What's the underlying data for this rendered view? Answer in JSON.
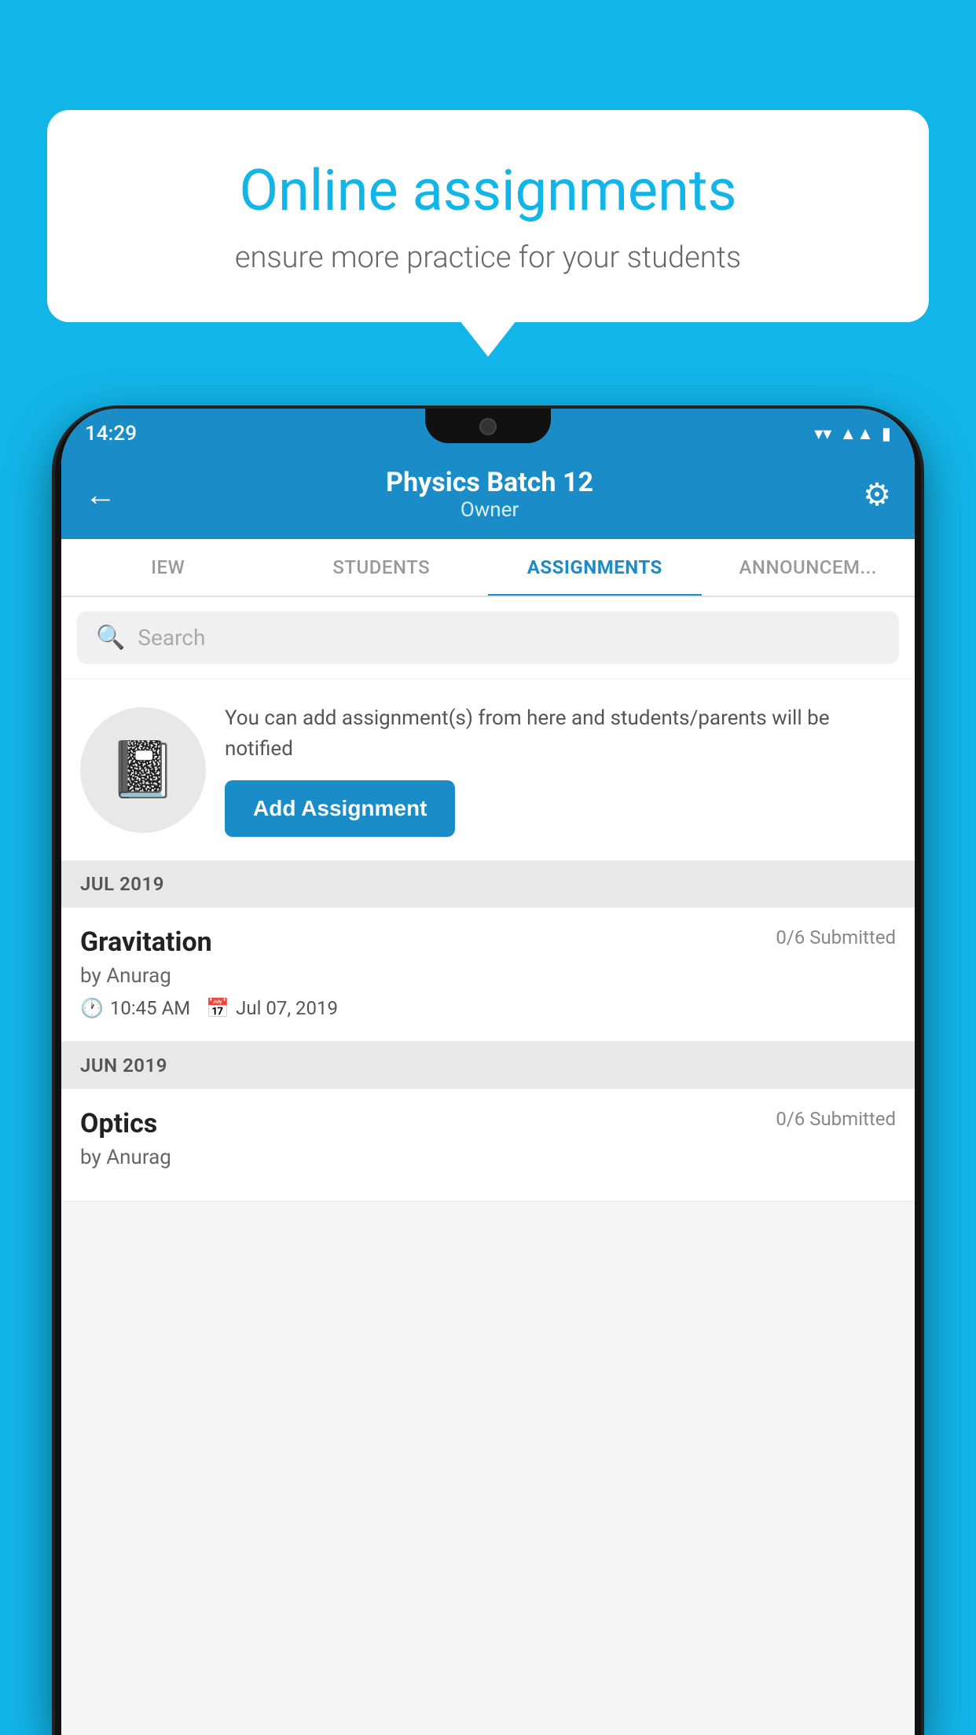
{
  "background_color": "#12B5E8",
  "speech_bubble": {
    "title": "Online assignments",
    "subtitle": "ensure more practice for your students"
  },
  "status_bar": {
    "time": "14:29",
    "wifi": "▼",
    "signal": "▲",
    "battery": "▮"
  },
  "header": {
    "title": "Physics Batch 12",
    "subtitle": "Owner",
    "back_label": "←",
    "gear_label": "⚙"
  },
  "tabs": [
    {
      "label": "IEW",
      "active": false
    },
    {
      "label": "STUDENTS",
      "active": false
    },
    {
      "label": "ASSIGNMENTS",
      "active": true
    },
    {
      "label": "ANNOUNCEM...",
      "active": false
    }
  ],
  "search": {
    "placeholder": "Search"
  },
  "empty_state": {
    "description": "You can add assignment(s) from here and students/parents will be notified",
    "button_label": "Add Assignment"
  },
  "sections": [
    {
      "month": "JUL 2019",
      "assignments": [
        {
          "name": "Gravitation",
          "submitted": "0/6 Submitted",
          "author": "by Anurag",
          "time": "10:45 AM",
          "date": "Jul 07, 2019"
        }
      ]
    },
    {
      "month": "JUN 2019",
      "assignments": [
        {
          "name": "Optics",
          "submitted": "0/6 Submitted",
          "author": "by Anurag",
          "time": "",
          "date": ""
        }
      ]
    }
  ]
}
